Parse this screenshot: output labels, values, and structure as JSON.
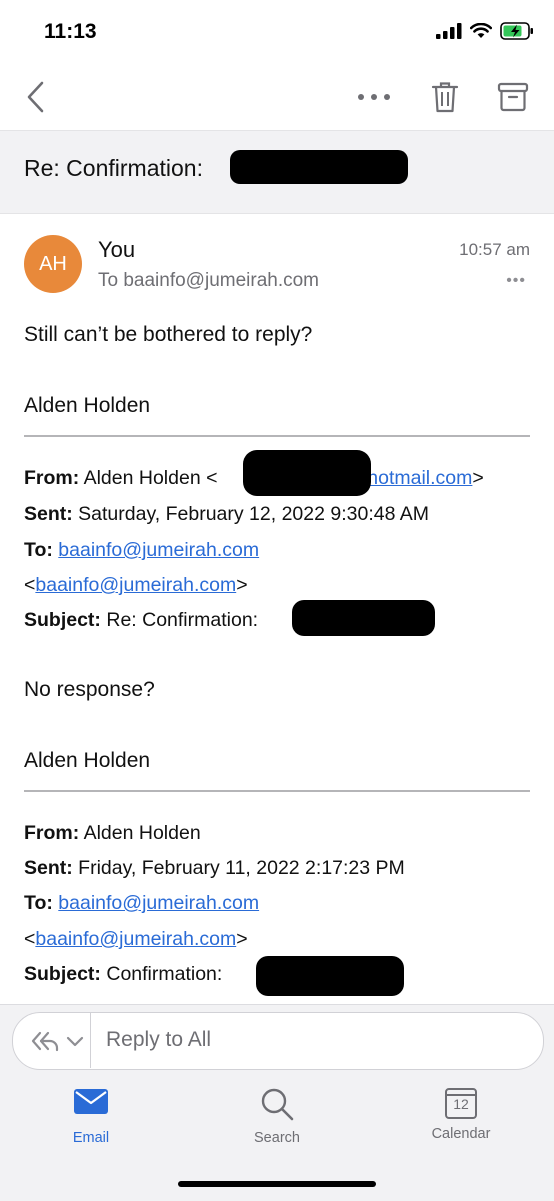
{
  "status_bar": {
    "time": "11:13"
  },
  "nav": {
    "icons": [
      "back-chevron-icon",
      "more-horizontal-icon",
      "trash-icon",
      "archive-icon"
    ]
  },
  "subject": {
    "text": "Re: Confirmation: "
  },
  "message": {
    "avatar_initials": "AH",
    "avatar_color": "#e8893a",
    "sender": "You",
    "to_line": "To baainfo@jumeirah.com",
    "time": "10:57 am",
    "more_dots": "•••",
    "body_line1": "Still can’t be bothered to reply?",
    "signature1": "Alden Holden",
    "quote1": {
      "from_label": "From:",
      "from_name": " Alden Holden <",
      "from_email_suffix": "@hotmail.com",
      "from_close": ">",
      "sent_label": "Sent:",
      "sent_value": " Saturday, February 12, 2022 9:30:48 AM",
      "to_label": "To:",
      "to_email": "baainfo@jumeirah.com",
      "to_email2_open": "<",
      "to_email2": "baainfo@jumeirah.com",
      "to_email2_close": ">",
      "subject_label": "Subject:",
      "subject_value": " Re: Confirmation:"
    },
    "body_line2": "No response?",
    "signature2": "Alden Holden",
    "quote2": {
      "from_label": "From:",
      "from_name": " Alden Holden",
      "sent_label": "Sent:",
      "sent_value": " Friday, February 11, 2022 2:17:23 PM",
      "to_label": "To:",
      "to_email": "baainfo@jumeirah.com",
      "to_email2_open": "<",
      "to_email2": "baainfo@jumeirah.com",
      "to_email2_close": ">",
      "subject_label": "Subject:",
      "subject_value": " Confirmation:"
    }
  },
  "reply_bar": {
    "placeholder": "Reply to All"
  },
  "tabs": [
    {
      "label": "Email",
      "icon": "envelope-icon",
      "active": true
    },
    {
      "label": "Search",
      "icon": "search-icon",
      "active": false
    },
    {
      "label": "Calendar",
      "icon": "calendar-icon",
      "calendar_day": "12",
      "active": false
    }
  ],
  "colors": {
    "accent": "#2a6bd6",
    "avatar": "#e8893a"
  }
}
